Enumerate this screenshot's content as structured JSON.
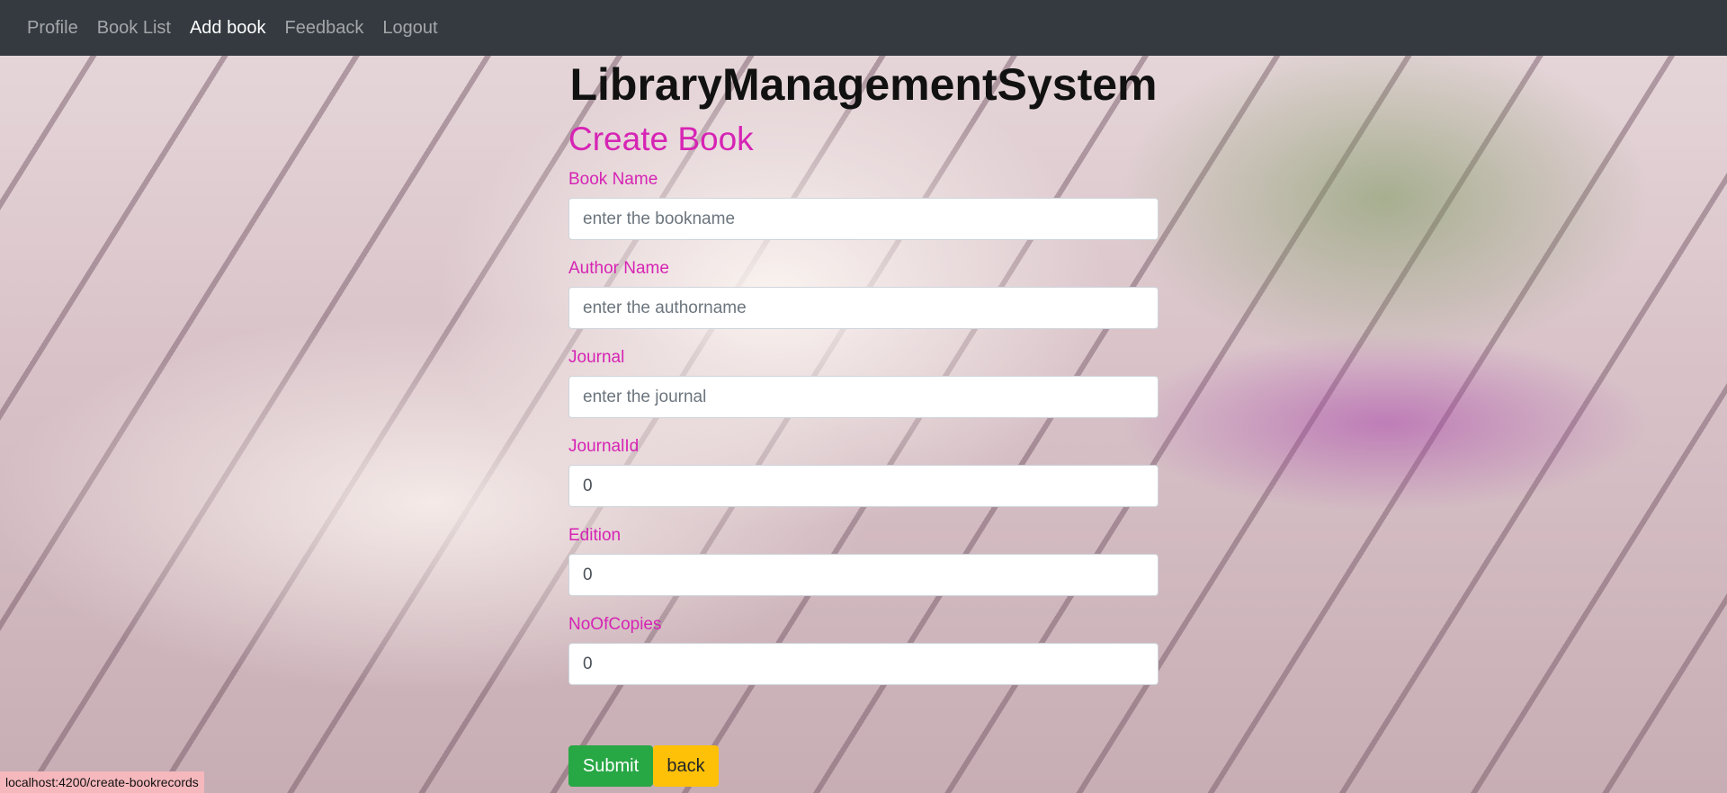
{
  "nav": {
    "items": [
      {
        "label": "Profile",
        "active": false
      },
      {
        "label": "Book List",
        "active": false
      },
      {
        "label": "Add book",
        "active": true
      },
      {
        "label": "Feedback",
        "active": false
      },
      {
        "label": "Logout",
        "active": false
      }
    ]
  },
  "header": {
    "title": "LibraryManagementSystem"
  },
  "form": {
    "heading": "Create Book",
    "fields": [
      {
        "label": "Book Name",
        "placeholder": "enter the bookname",
        "value": ""
      },
      {
        "label": "Author Name",
        "placeholder": "enter the authorname",
        "value": ""
      },
      {
        "label": "Journal",
        "placeholder": "enter the journal",
        "value": ""
      },
      {
        "label": "JournalId",
        "placeholder": "",
        "value": "0"
      },
      {
        "label": "Edition",
        "placeholder": "",
        "value": "0"
      },
      {
        "label": "NoOfCopies",
        "placeholder": "",
        "value": "0"
      }
    ],
    "submit_label": "Submit",
    "back_label": "back"
  },
  "status_bar": {
    "url": "localhost:4200/create-bookrecords"
  },
  "colors": {
    "navbar": "#343a40",
    "accent": "#d624b4",
    "submit": "#28a745",
    "back": "#ffc107"
  }
}
